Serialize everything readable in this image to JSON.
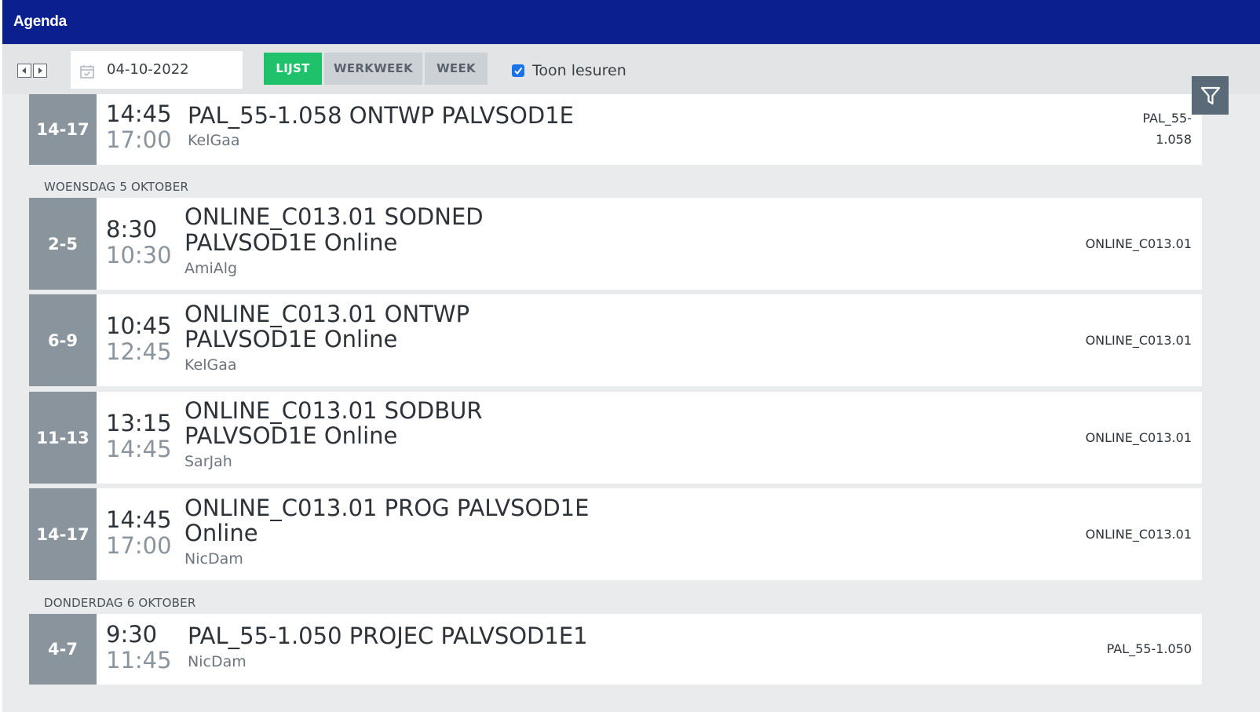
{
  "app": {
    "title": "Agenda"
  },
  "toolbar": {
    "date_value": "04-10-2022",
    "tabs": [
      {
        "label": "LIJST",
        "active": true
      },
      {
        "label": "WERKWEEK",
        "active": false
      },
      {
        "label": "WEEK",
        "active": false
      }
    ],
    "show_lesuren": {
      "label": "Toon lesuren",
      "checked": true
    }
  },
  "colors": {
    "header": "#0b1f8f",
    "active_tab": "#1fc26a",
    "slot": "#8a949c",
    "filter_button": "#5a6a78"
  },
  "icons": {
    "nav_prev": "triangle-left",
    "nav_next": "triangle-right",
    "date": "calendar-check",
    "filter": "funnel"
  },
  "days": [
    {
      "label": "",
      "events": [
        {
          "slot": "14-17",
          "start": "14:45",
          "end": "17:00",
          "title": "PAL_55-1.058 ONTWP PALVSOD1E",
          "teacher": "KelGaa",
          "room_line1": "PAL_55-",
          "room_line2": "1.058"
        }
      ]
    },
    {
      "label": "WOENSDAG 5 OKTOBER",
      "events": [
        {
          "slot": "2-5",
          "start": "8:30",
          "end": "10:30",
          "title_line1": "ONLINE_C013.01 SODNED",
          "title_line2": "PALVSOD1E Online",
          "teacher": "AmiAlg",
          "room": "ONLINE_C013.01"
        },
        {
          "slot": "6-9",
          "start": "10:45",
          "end": "12:45",
          "title_line1": "ONLINE_C013.01 ONTWP",
          "title_line2": "PALVSOD1E Online",
          "teacher": "KelGaa",
          "room": "ONLINE_C013.01"
        },
        {
          "slot": "11-13",
          "start": "13:15",
          "end": "14:45",
          "title_line1": "ONLINE_C013.01 SODBUR",
          "title_line2": "PALVSOD1E Online",
          "teacher": "SarJah",
          "room": "ONLINE_C013.01"
        },
        {
          "slot": "14-17",
          "start": "14:45",
          "end": "17:00",
          "title_line1": "ONLINE_C013.01 PROG PALVSOD1E",
          "title_line2": "Online",
          "teacher": "NicDam",
          "room": "ONLINE_C013.01"
        }
      ]
    },
    {
      "label": "DONDERDAG 6 OKTOBER",
      "events": [
        {
          "slot": "4-7",
          "start": "9:30",
          "end": "11:45",
          "title": "PAL_55-1.050 PROJEC PALVSOD1E1",
          "teacher": "NicDam",
          "room": "PAL_55-1.050"
        }
      ]
    }
  ]
}
